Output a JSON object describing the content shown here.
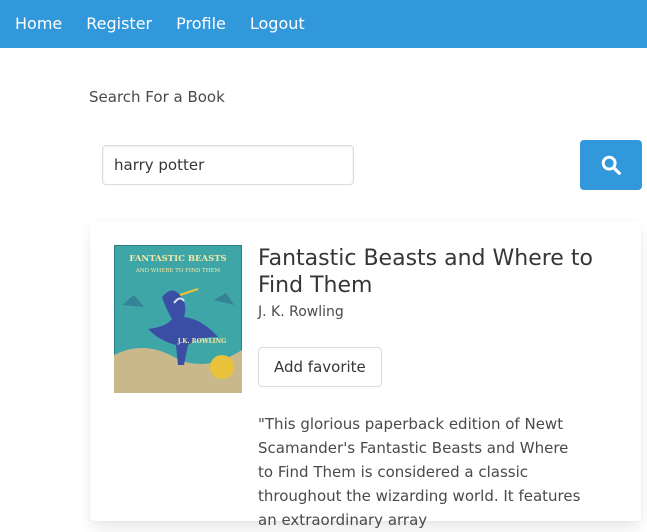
{
  "nav": {
    "items": [
      {
        "label": "Home"
      },
      {
        "label": "Register"
      },
      {
        "label": "Profile"
      },
      {
        "label": "Logout"
      }
    ]
  },
  "search": {
    "heading": "Search For a Book",
    "value": "harry potter",
    "button_icon": "search-icon"
  },
  "result": {
    "title": "Fantastic Beasts and Where to Find Them",
    "author": "J. K. Rowling",
    "favorite_label": "Add favorite",
    "description": "\"This glorious paperback edition of Newt Scamander's Fantastic Beasts and Where to Find Them is considered a classic throughout the wizarding world. It features an extraordinary array",
    "cover_text": {
      "line1": "FANTASTIC BEASTS",
      "line2": "AND WHERE TO FIND THEM",
      "author": "J.K. ROWLING"
    }
  },
  "colors": {
    "primary": "#3298dc",
    "cover_bg": "#3fa6a8"
  }
}
